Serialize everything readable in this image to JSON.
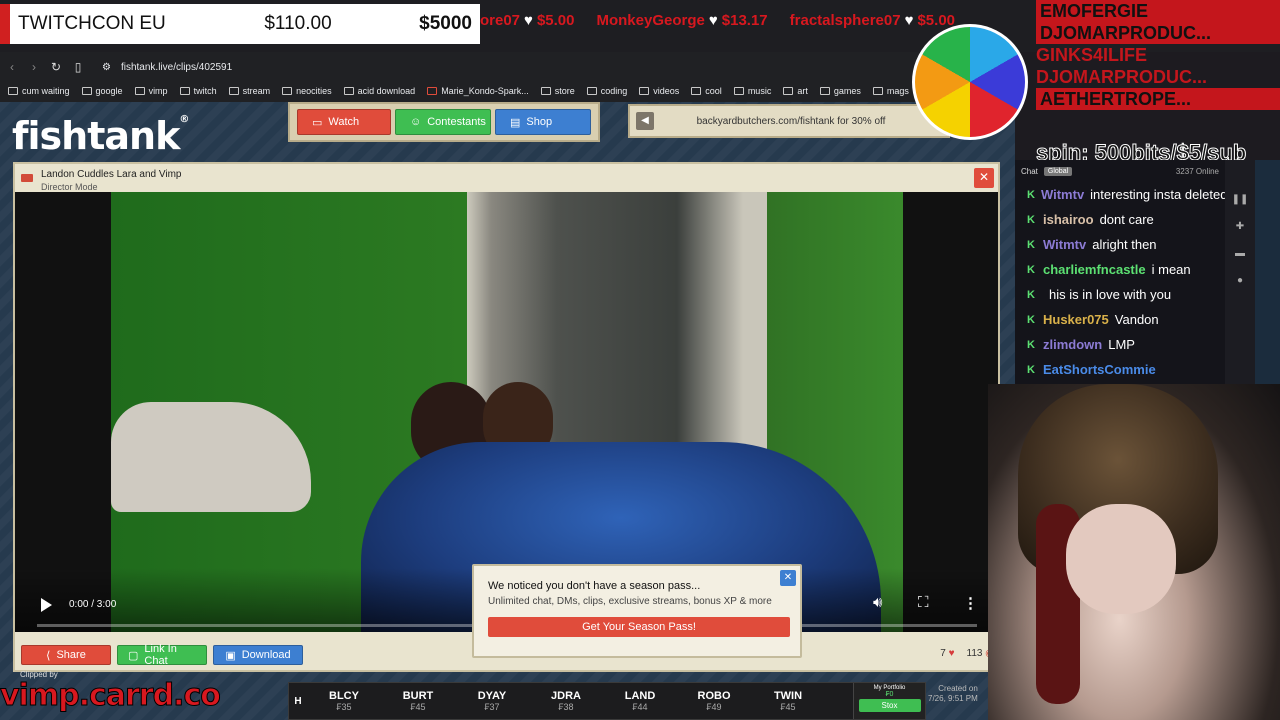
{
  "overlay": {
    "goal_title": "TWITCHCON EU",
    "goal_current": "$110.00",
    "goal_target": "$5000",
    "ticker": [
      {
        "name": "ore07",
        "amount": "$5.00"
      },
      {
        "name": "MonkeyGeorge",
        "amount": "$13.17"
      },
      {
        "name": "fractalsphere07",
        "amount": "$5.00"
      }
    ],
    "donors": [
      "EMOFERGIE",
      "DJOMARPRODUC...",
      "GINKS4ILIFE",
      "DJOMARPRODUC...",
      "AETHERTROPE..."
    ],
    "spin_text": "spin: 500bits/$5/sub",
    "wheel_colors": [
      "#2aa8e8",
      "#3b3bd8",
      "#e0242d",
      "#f5d200",
      "#f39a13",
      "#28b34a"
    ]
  },
  "browser": {
    "url": "fishtank.live/clips/402591",
    "bookmarks": [
      "cum waiting",
      "google",
      "vimp",
      "twitch",
      "stream",
      "neocities",
      "acid download",
      "Marie_Kondo-Spark...",
      "store",
      "coding",
      "videos",
      "cool",
      "music",
      "art",
      "games",
      "mags"
    ]
  },
  "site": {
    "logo": "fishtank",
    "nav": {
      "watch": "Watch",
      "contestants": "Contestants",
      "shop": "Shop"
    },
    "promo": "backyardbutchers.com/fishtank for 30% off",
    "player": {
      "title": "Landon Cuddles Lara and Vimp",
      "subtitle": "Director Mode",
      "time": "0:00 / 3:00",
      "progress": 0
    },
    "actions": {
      "share": "Share",
      "link": "Link In Chat",
      "download": "Download"
    },
    "stats": {
      "likes": "7",
      "views": "113"
    },
    "season_pass": {
      "title": "We noticed you don't have a season pass...",
      "desc": "Unlimited chat, DMs, clips, exclusive streams, bonus XP & more",
      "cta": "Get Your Season Pass!"
    },
    "clipped_by": "Clipped by",
    "watermark": "vimp.carrd.co",
    "stock_ticker": [
      {
        "sym": "BLCY",
        "price": "₣35"
      },
      {
        "sym": "BURT",
        "price": "₣45"
      },
      {
        "sym": "DYAY",
        "price": "₣37"
      },
      {
        "sym": "JDRA",
        "price": "₣38"
      },
      {
        "sym": "LAND",
        "price": "₣44"
      },
      {
        "sym": "ROBO",
        "price": "₣49"
      },
      {
        "sym": "TWIN",
        "price": "₣45"
      }
    ],
    "portfolio": {
      "label": "My Portfolio",
      "value": "₣0",
      "btn": "Stox"
    },
    "created": {
      "label": "Created on",
      "date": "7/26, 9:51 PM"
    }
  },
  "chat": {
    "label": "Chat",
    "chip": "Global",
    "online": "3237 Online",
    "lines": [
      {
        "user": "Witmtv",
        "msg": "interesting insta deleted",
        "color": "#8c7bd4"
      },
      {
        "user": "ishairoo",
        "msg": "dont care",
        "color": "#d8c0a8"
      },
      {
        "user": "Witmtv",
        "msg": "alright then",
        "color": "#8c7bd4"
      },
      {
        "user": "charliemfncastle",
        "msg": "i mean",
        "color": "#5ce072"
      },
      {
        "user": "",
        "msg": "his is in love with you",
        "color": "#fff"
      },
      {
        "user": "Husker075",
        "msg": "Vandon",
        "color": "#d9b14a"
      },
      {
        "user": "zlimdown",
        "msg": "LMP",
        "color": "#8c7bd4"
      },
      {
        "user": "EatShortsCommie",
        "msg": "",
        "color": "#4a8be8"
      }
    ]
  }
}
